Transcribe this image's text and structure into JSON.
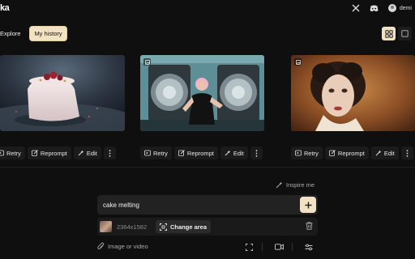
{
  "app": {
    "logo_text": "ka",
    "username": "demi"
  },
  "top_icons": [
    "x-logo-icon",
    "discord-icon",
    "user-avatar"
  ],
  "tabs": [
    {
      "label": "Explore",
      "active": false
    },
    {
      "label": "My history",
      "active": true
    }
  ],
  "view_toggle": {
    "selected": "grid-view"
  },
  "cards": [
    {
      "subject": "melting-cake"
    },
    {
      "subject": "woman-with-speakers"
    },
    {
      "subject": "woman-portrait"
    }
  ],
  "card_actions": {
    "retry": "Retry",
    "reprompt": "Reprompt",
    "edit": "Edit"
  },
  "inspire_label": "Inspire me",
  "prompt": {
    "value": "cake melting"
  },
  "reference": {
    "dimensions": "2364x1582",
    "change_area_label": "Change area"
  },
  "attach_label": "Image or video",
  "colors": {
    "accent": "#f1e2c4",
    "background": "#0f0f0f",
    "panel": "#222222"
  }
}
